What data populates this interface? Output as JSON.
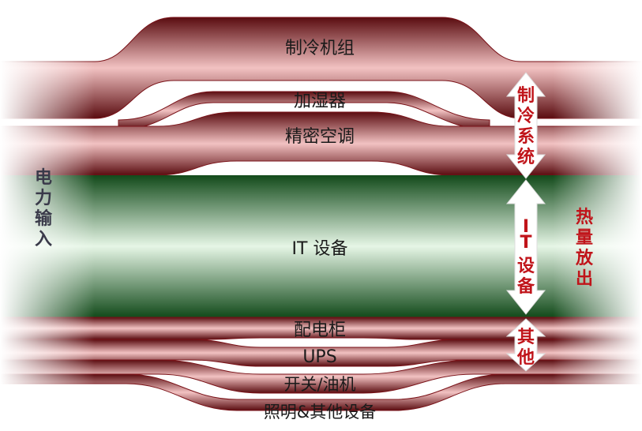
{
  "diagram": {
    "input_label": [
      "电",
      "力",
      "输",
      "入"
    ],
    "output_label": [
      "热",
      "量",
      "放",
      "出"
    ],
    "flows": {
      "chiller": "制冷机组",
      "humidifier": "加湿器",
      "precision_ac": "精密空调",
      "it_equipment": "IT 设备",
      "switchgear": "配电柜",
      "ups": "UPS",
      "switch_generator": "开关/油机",
      "lighting_other": "照明&其他设备"
    },
    "groups": {
      "cooling": [
        "制",
        "冷",
        "系",
        "统"
      ],
      "it": [
        "I",
        "T",
        "设",
        "备"
      ],
      "other": [
        "其",
        "他"
      ]
    },
    "colors": {
      "pipe_red": "#8b1a20",
      "pipe_green": "#1f6a2a",
      "label_red": "#c0141a",
      "label_dark": "#3a3a4a"
    }
  }
}
